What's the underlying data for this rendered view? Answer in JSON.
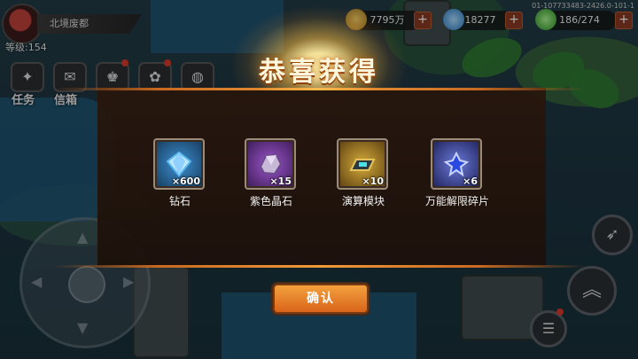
{
  "build_id": "01-107733483-2426.0-101-1",
  "player": {
    "location": "北境废都",
    "level": "等级:154"
  },
  "hud_buttons": [
    {
      "label": "任务",
      "icon": "quest-icon"
    },
    {
      "label": "信箱",
      "icon": "mailbox-icon"
    },
    {
      "label": "",
      "icon": "rank-icon",
      "has_badge": true
    },
    {
      "label": "",
      "icon": "flower-icon",
      "has_badge": true
    },
    {
      "label": "",
      "icon": "globe-icon"
    }
  ],
  "resources": [
    {
      "value": "7795万",
      "icon": "coin-icon",
      "color": "#c9a23a"
    },
    {
      "value": "18277",
      "icon": "diamond-icon",
      "color": "#4aa8e8"
    },
    {
      "value": "186/274",
      "icon": "stamina-icon",
      "color": "#4fc24a"
    }
  ],
  "dialog": {
    "title": "恭喜获得",
    "confirm_label": "确认",
    "rewards": [
      {
        "name": "钻石",
        "qty": "×600",
        "icon": "diamond-icon",
        "frame_color": "#2a5d86"
      },
      {
        "name": "紫色晶石",
        "qty": "×15",
        "icon": "purple-crystal-icon",
        "frame_color": "#5a2c7a"
      },
      {
        "name": "演算模块",
        "qty": "×10",
        "icon": "compute-module-icon",
        "frame_color": "#8a6a1a"
      },
      {
        "name": "万能解限碎片",
        "qty": "×6",
        "icon": "limit-shard-icon",
        "frame_color": "#3a3f8a"
      }
    ]
  }
}
